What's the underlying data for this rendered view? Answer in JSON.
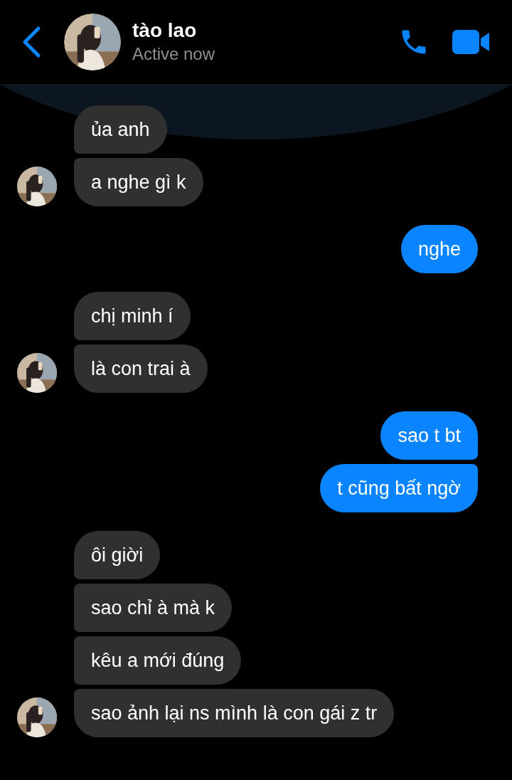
{
  "header": {
    "title": "tào lao",
    "status": "Active now"
  },
  "groups": [
    {
      "kind": "received",
      "messages": [
        "ủa anh",
        "a nghe gì k"
      ]
    },
    {
      "kind": "sent",
      "messages": [
        "nghe"
      ]
    },
    {
      "kind": "received",
      "messages": [
        "chị minh í",
        "là con trai à"
      ]
    },
    {
      "kind": "sent",
      "messages": [
        "sao t bt",
        "t cũng bất ngờ"
      ]
    },
    {
      "kind": "received",
      "messages": [
        "ôi giời",
        "sao chỉ à mà k",
        "kêu a mới đúng",
        "sao ảnh lại ns mình là con gái z tr"
      ]
    }
  ]
}
